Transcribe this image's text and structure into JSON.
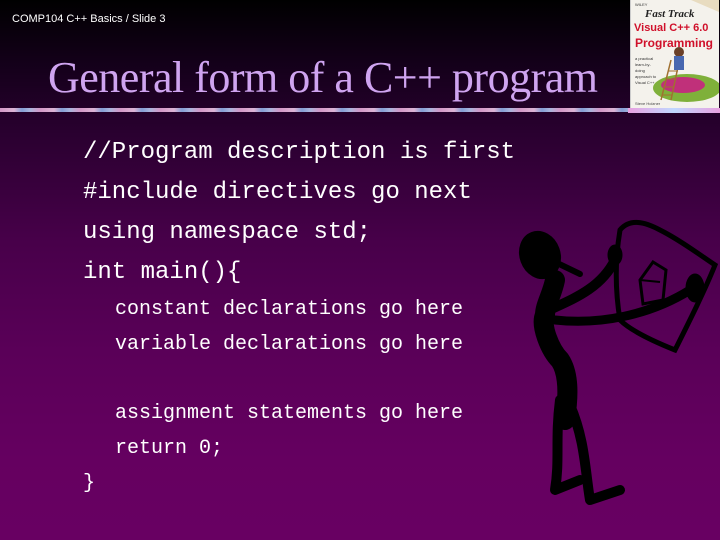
{
  "header": {
    "slide_label": "COMP104 C++ Basics / Slide 3",
    "title": "General form of a C++ program"
  },
  "book_cover": {
    "publisher": "WILEY",
    "title_line1": "Fast Track",
    "title_line2": "Visual C++ 6.0",
    "title_line3": "Programming",
    "blurb": "a practical learn-by-doing approach to Visual C++",
    "author": "Steve Holzner"
  },
  "code": {
    "top_lines": [
      "//Program description is first",
      "#include directives go next",
      "using namespace std;",
      "int main(){"
    ],
    "body_lines": [
      "constant declarations go here",
      "variable declarations go here",
      "assignment statements go here",
      "return 0;"
    ],
    "closing": "}"
  },
  "colors": {
    "title": "#cfa4f0",
    "text": "#ffffff",
    "background_top": "#000000",
    "background_bottom": "#650060"
  },
  "clipart": {
    "icon": "stick-figure-holding-frame"
  }
}
